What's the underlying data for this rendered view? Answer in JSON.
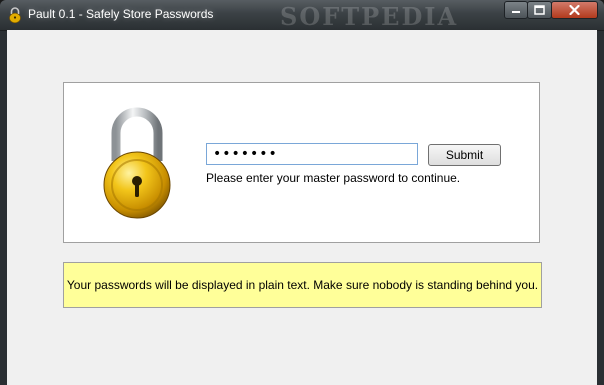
{
  "window": {
    "title": "Pault 0.1 - Safely Store Passwords",
    "watermark": "SOFTPEDIA",
    "controls": {
      "minimize_icon": "minimize-icon",
      "maximize_icon": "maximize-icon",
      "close_icon": "close-icon"
    }
  },
  "login": {
    "icon": "padlock-icon",
    "password_value": "●●●●●●●",
    "submit_label": "Submit",
    "hint": "Please enter your master password to continue."
  },
  "warning": {
    "text": "Your passwords will be displayed in plain text. Make sure nobody is standing behind you.",
    "background": "#ffff99"
  },
  "colors": {
    "titlebar": "#3b4145",
    "client": "#f0f0f0",
    "lock_gold": "#d8a500",
    "close_button": "#b23a1d"
  }
}
